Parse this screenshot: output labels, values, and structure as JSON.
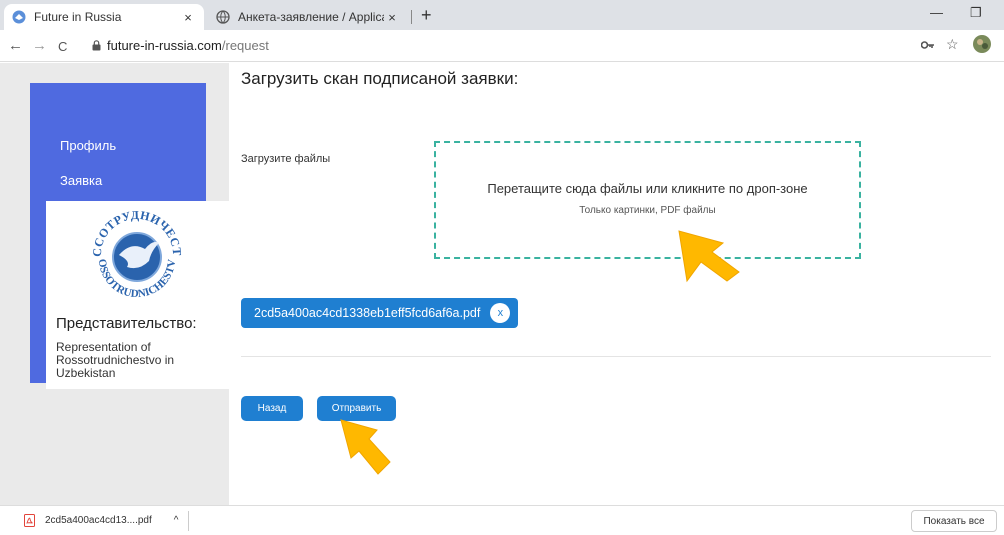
{
  "browser": {
    "tabs": [
      {
        "title": "Future in Russia",
        "close": "×"
      },
      {
        "title": "Анкета-заявление / Application",
        "close": "×"
      }
    ],
    "new_tab": "+",
    "win_min": "—",
    "win_restore": "❐",
    "url_host": "future-in-russia.com",
    "url_path": "/request",
    "back": "←",
    "forward": "→",
    "reload": "C"
  },
  "sidebar": {
    "items": [
      {
        "label": "Профиль"
      },
      {
        "label": "Заявка"
      }
    ],
    "representation": {
      "title": "Представительство:",
      "name": "Representation of Rossotrudnichestvo in Uzbekistan"
    }
  },
  "main": {
    "title": "Загрузить скан подписаной заявки:",
    "upload_label": "Загрузите файлы",
    "dropzone_text": "Перетащите сюда файлы или кликните по дроп-зоне",
    "dropzone_hint": "Только картинки, PDF файлы",
    "file_name": "2cd5a400ac4cd1338eb1eff5fcd6af6a.pdf",
    "file_remove": "x",
    "back_button": "Назад",
    "submit_button": "Отправить"
  },
  "downloads": {
    "file": "2cd5a400ac4cd13....pdf",
    "chevron": "^",
    "show_all": "Показать все"
  },
  "colors": {
    "sidebar": "#4f6ae0",
    "primary": "#1f7fd1",
    "dropzone_border": "#3ab2a0",
    "arrow": "#ffb800"
  }
}
